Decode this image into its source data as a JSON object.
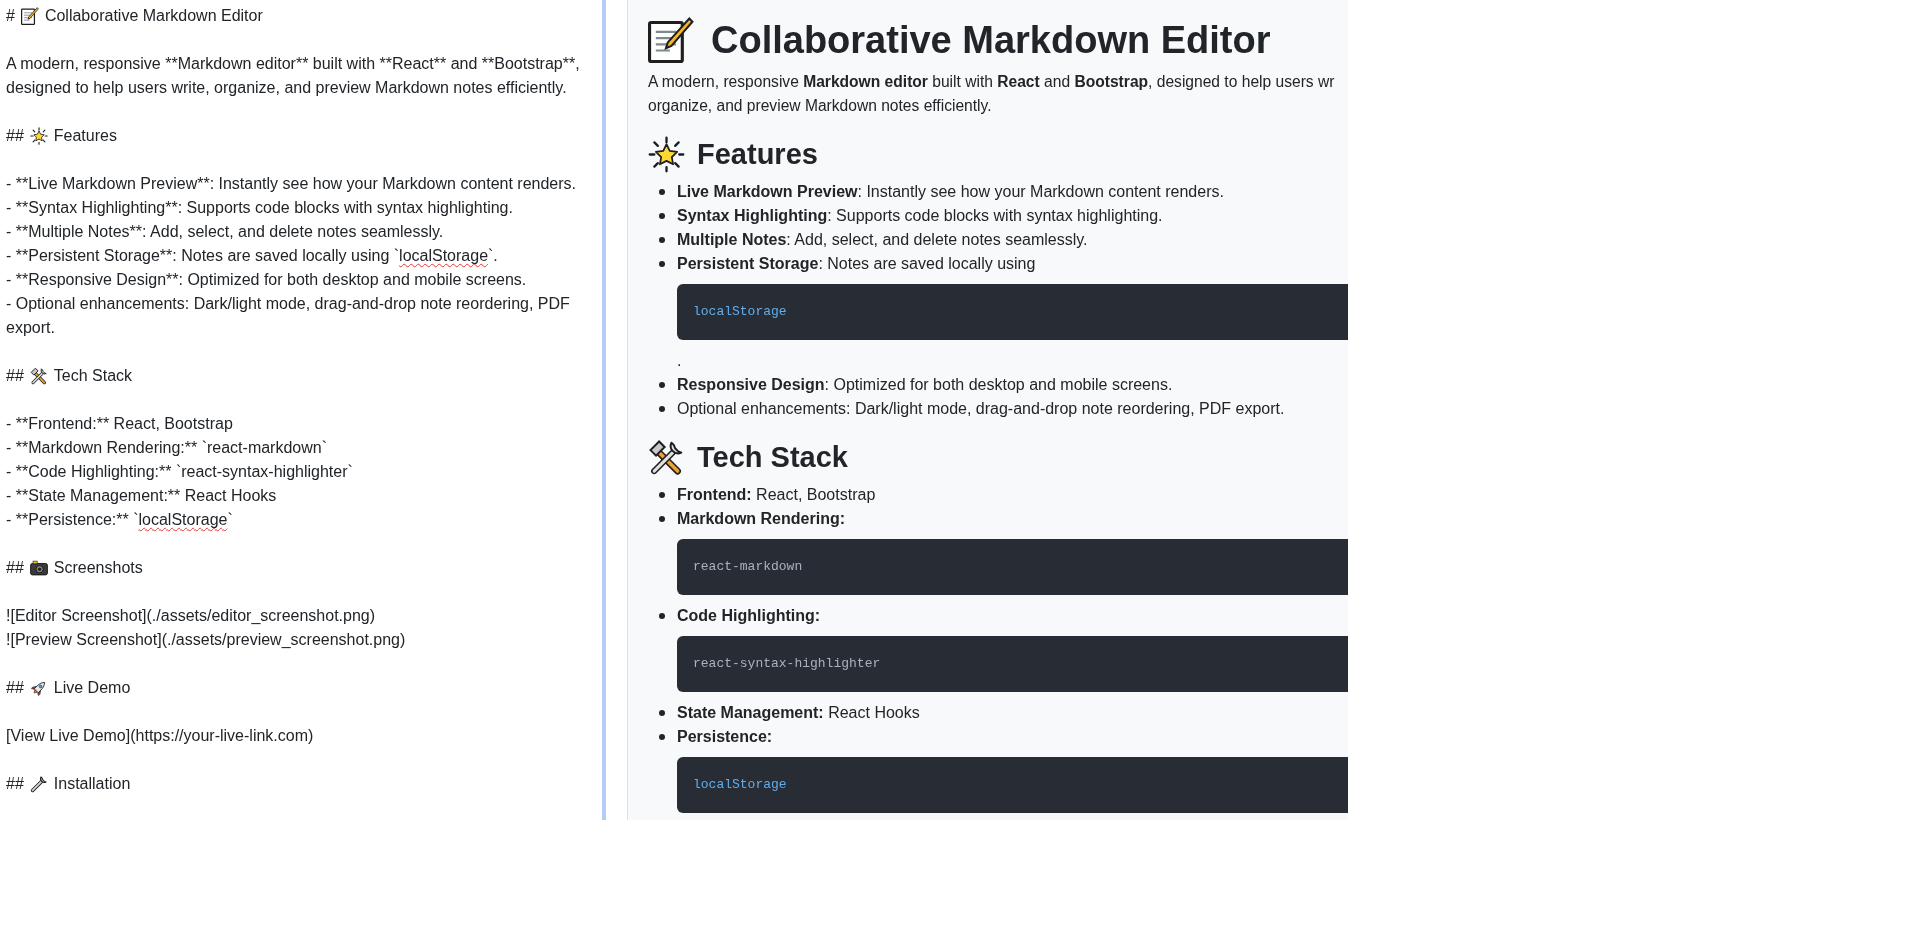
{
  "editor": {
    "blocks": [
      [
        {
          "kind": "heading",
          "marker": "#",
          "text": "Collaborative Markdown Editor"
        }
      ],
      [
        {
          "kind": "text",
          "text": "A modern, responsive **Markdown editor** built with **React** and **Bootstrap**, designed to help users write, organize, and preview Markdown notes efficiently."
        }
      ],
      [
        {
          "kind": "heading",
          "marker": "##",
          "text": "Features"
        }
      ],
      [
        {
          "kind": "text",
          "text": "- **Live Markdown Preview**: Instantly see how your Markdown content renders."
        },
        {
          "kind": "text",
          "text": "- **Syntax Highlighting**: Supports code blocks with syntax highlighting."
        },
        {
          "kind": "text",
          "text": "- **Multiple Notes**: Add, select, and delete notes seamlessly."
        },
        {
          "kind": "text",
          "segments": [
            {
              "text": "- **Persistent Storage**: Notes are saved locally using `",
              "misspelled": false
            },
            {
              "text": "localStorage",
              "misspelled": true
            },
            {
              "text": "`.",
              "misspelled": false
            }
          ]
        },
        {
          "kind": "text",
          "text": "- **Responsive Design**: Optimized for both desktop and mobile screens."
        },
        {
          "kind": "text",
          "text": "- Optional enhancements: Dark/light mode, drag-and-drop note reordering, PDF export."
        }
      ],
      [
        {
          "kind": "heading",
          "marker": "##",
          "text": "Tech Stack"
        }
      ],
      [
        {
          "kind": "text",
          "text": "- **Frontend:** React, Bootstrap"
        },
        {
          "kind": "text",
          "text": "- **Markdown Rendering:** `react-markdown`"
        },
        {
          "kind": "text",
          "text": "- **Code Highlighting:** `react-syntax-highlighter`"
        },
        {
          "kind": "text",
          "text": "- **State Management:** React Hooks"
        },
        {
          "kind": "text",
          "segments": [
            {
              "text": "- **Persistence:** `",
              "misspelled": false
            },
            {
              "text": "localStorage",
              "misspelled": true
            },
            {
              "text": "`",
              "misspelled": false
            }
          ]
        }
      ],
      [
        {
          "kind": "heading",
          "marker": "##",
          "text": "Screenshots"
        }
      ],
      [
        {
          "kind": "text",
          "text": "![Editor Screenshot](./assets/editor_screenshot.png)"
        },
        {
          "kind": "text",
          "text": "![Preview Screenshot](./assets/preview_screenshot.png)"
        }
      ],
      [
        {
          "kind": "heading",
          "marker": "##",
          "text": "Live Demo"
        }
      ],
      [
        {
          "kind": "text",
          "text": "[View Live Demo](https://your-live-link.com)"
        }
      ],
      [
        {
          "kind": "heading",
          "marker": "##",
          "text": "Installation"
        }
      ]
    ]
  },
  "preview": {
    "title": "Collaborative Markdown Editor",
    "intro": [
      "A modern, responsive **Markdown editor** built with **React** and **Bootstrap**, designed to help users wr",
      "organize, and preview Markdown notes efficiently."
    ],
    "sections": [
      {
        "heading": "Features",
        "items": [
          {
            "parts": [
              {
                "kind": "text",
                "text": "**Live Markdown Preview**: Instantly see how your Markdown content renders."
              }
            ]
          },
          {
            "parts": [
              {
                "kind": "text",
                "text": "**Syntax Highlighting**: Supports code blocks with syntax highlighting."
              }
            ]
          },
          {
            "parts": [
              {
                "kind": "text",
                "text": "**Multiple Notes**: Add, select, and delete notes seamlessly."
              }
            ]
          },
          {
            "parts": [
              {
                "kind": "text",
                "text": "**Persistent Storage**: Notes are saved locally using"
              },
              {
                "kind": "code",
                "text": "localStorage",
                "color": "#61aeee"
              },
              {
                "kind": "text",
                "text": "."
              }
            ]
          },
          {
            "parts": [
              {
                "kind": "text",
                "text": "**Responsive Design**: Optimized for both desktop and mobile screens."
              }
            ]
          },
          {
            "parts": [
              {
                "kind": "text",
                "text": "Optional enhancements: Dark/light mode, drag-and-drop note reordering, PDF export."
              }
            ]
          }
        ]
      },
      {
        "heading": "Tech Stack",
        "items": [
          {
            "parts": [
              {
                "kind": "text",
                "text": "**Frontend:** React, Bootstrap"
              }
            ]
          },
          {
            "parts": [
              {
                "kind": "label",
                "text": "Markdown Rendering:"
              },
              {
                "kind": "code",
                "text": "react-markdown",
                "color": "#abb2bf"
              }
            ]
          },
          {
            "parts": [
              {
                "kind": "label",
                "text": "Code Highlighting:"
              },
              {
                "kind": "code",
                "text": "react-syntax-highlighter",
                "color": "#abb2bf"
              }
            ]
          },
          {
            "parts": [
              {
                "kind": "text",
                "text": "**State Management:** React Hooks"
              }
            ]
          },
          {
            "parts": [
              {
                "kind": "label",
                "text": "Persistence:"
              },
              {
                "kind": "code",
                "text": "localStorage",
                "color": "#61aeee"
              }
            ]
          }
        ]
      }
    ]
  }
}
